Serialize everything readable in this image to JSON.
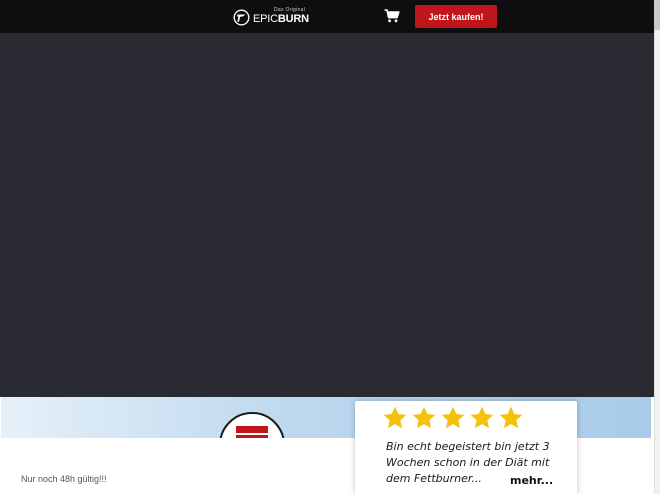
{
  "header": {
    "logo": {
      "subtitle": "Das Original",
      "name_light": "EPIC",
      "name_bold": "BURN"
    },
    "buy_label": "Jetzt kaufen!",
    "cart_icon": "shopping-cart-icon"
  },
  "colors": {
    "header_bg": "#0e0e10",
    "hero_bg": "#2a2a33",
    "accent_red": "#c0151b",
    "star_yellow": "#f4c20d"
  },
  "review": {
    "rating": 5,
    "text": "Bin echt begeistert bin jetzt 3 Wochen schon in der Diät mit dem Fettburner...",
    "more_label": "mehr..."
  },
  "footer": {
    "countdown_text": "Nur noch 48h gültig!!!"
  }
}
